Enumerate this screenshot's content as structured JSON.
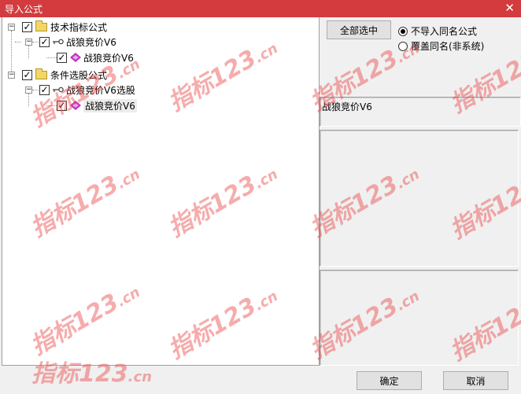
{
  "window": {
    "title": "导入公式",
    "close_glyph": "✕"
  },
  "tree": {
    "groups": [
      {
        "label": "技术指标公式",
        "expander": "−",
        "checked": true,
        "children": [
          {
            "label": "战狼竞价V6",
            "expander": "−",
            "checked": true,
            "children": [
              {
                "label": "战狼竞价V6",
                "checked": true
              }
            ]
          }
        ]
      },
      {
        "label": "条件选股公式",
        "expander": "−",
        "checked": true,
        "children": [
          {
            "label": "战狼竞价V6选股",
            "expander": "−",
            "checked": true,
            "children": [
              {
                "label": "战狼竞价V6",
                "checked": true,
                "selected": true
              }
            ]
          }
        ]
      }
    ]
  },
  "side": {
    "select_all_label": "全部选中",
    "options": [
      {
        "label": "不导入同名公式",
        "selected": true
      },
      {
        "label": "覆盖同名(非系统)",
        "selected": false
      }
    ],
    "formula_name": "战狼竞价V6"
  },
  "footer": {
    "ok_label": "确定",
    "cancel_label": "取消"
  },
  "watermark": {
    "text": "指标123",
    "suffix": ".cn",
    "color": "#eb4646"
  }
}
